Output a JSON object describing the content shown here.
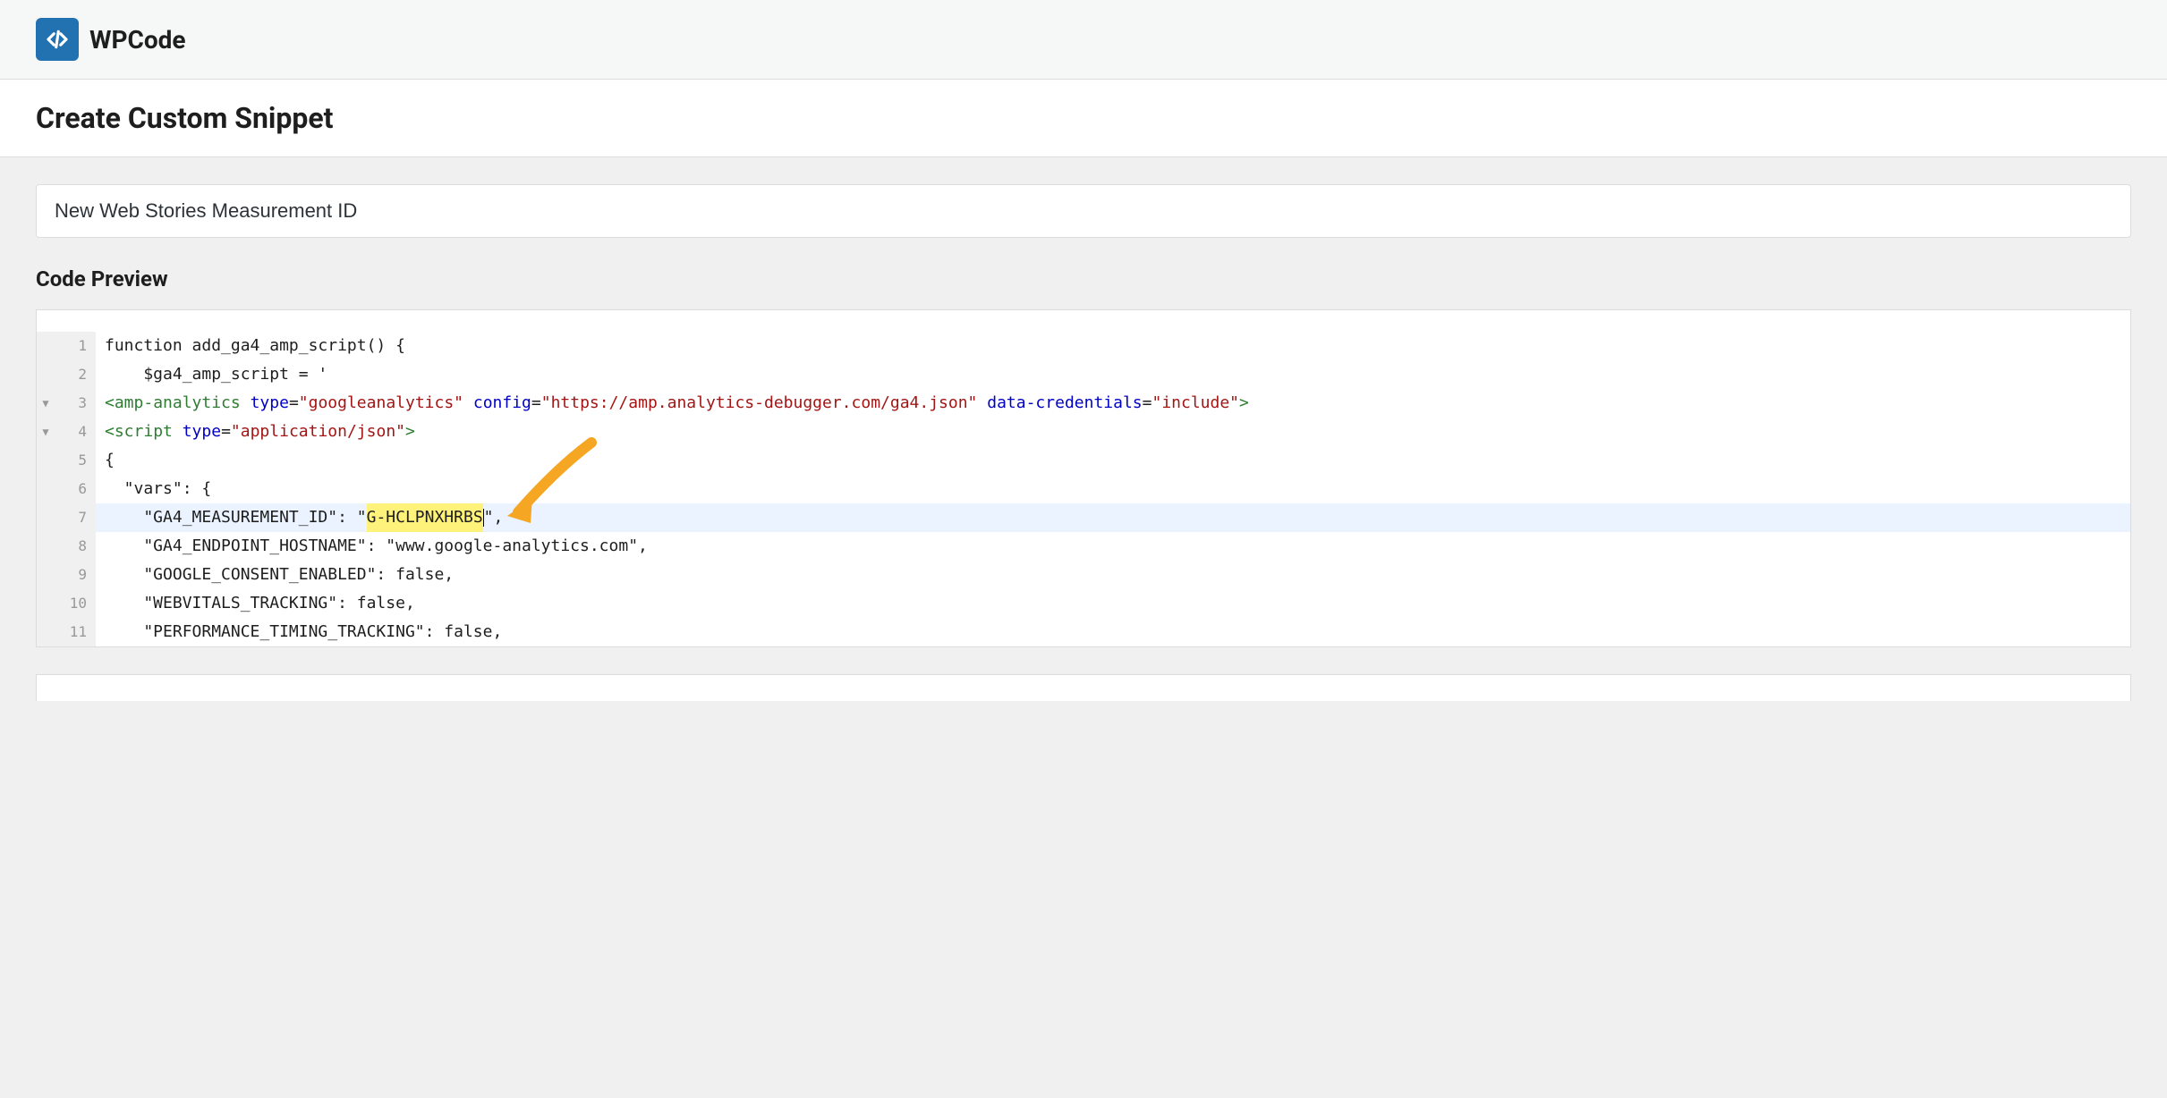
{
  "brand": {
    "name": "WPCode"
  },
  "page": {
    "title": "Create Custom Snippet"
  },
  "snippet": {
    "title_value": "New Web Stories Measurement ID"
  },
  "sections": {
    "code_preview_label": "Code Preview"
  },
  "code": {
    "lines": [
      {
        "num": "1",
        "fold": "",
        "tokens": [
          {
            "t": "function add_ga4_amp_script() {",
            "c": "tok-keyword"
          }
        ]
      },
      {
        "num": "2",
        "fold": "",
        "tokens": [
          {
            "t": "    $ga4_amp_script = '",
            "c": "tok-keyword"
          }
        ]
      },
      {
        "num": "3",
        "fold": "▼",
        "tokens": [
          {
            "t": "<",
            "c": "tok-tag"
          },
          {
            "t": "amp-analytics",
            "c": "tok-tag"
          },
          {
            "t": " ",
            "c": ""
          },
          {
            "t": "type",
            "c": "tok-attr"
          },
          {
            "t": "=",
            "c": "tok-punct"
          },
          {
            "t": "\"googleanalytics\"",
            "c": "tok-string"
          },
          {
            "t": " ",
            "c": ""
          },
          {
            "t": "config",
            "c": "tok-attr"
          },
          {
            "t": "=",
            "c": "tok-punct"
          },
          {
            "t": "\"https://amp.analytics-debugger.com/ga4.json\"",
            "c": "tok-string"
          },
          {
            "t": " ",
            "c": ""
          },
          {
            "t": "data-credentials",
            "c": "tok-attr"
          },
          {
            "t": "=",
            "c": "tok-punct"
          },
          {
            "t": "\"include\"",
            "c": "tok-string"
          },
          {
            "t": ">",
            "c": "tok-tag"
          }
        ]
      },
      {
        "num": "4",
        "fold": "▼",
        "tokens": [
          {
            "t": "<",
            "c": "tok-tag"
          },
          {
            "t": "script",
            "c": "tok-tag"
          },
          {
            "t": " ",
            "c": ""
          },
          {
            "t": "type",
            "c": "tok-attr"
          },
          {
            "t": "=",
            "c": "tok-punct"
          },
          {
            "t": "\"application/json\"",
            "c": "tok-string"
          },
          {
            "t": ">",
            "c": "tok-tag"
          }
        ]
      },
      {
        "num": "5",
        "fold": "",
        "tokens": [
          {
            "t": "{",
            "c": "tok-keyword"
          }
        ]
      },
      {
        "num": "6",
        "fold": "",
        "tokens": [
          {
            "t": "  \"vars\": {",
            "c": "tok-keyword"
          }
        ]
      },
      {
        "num": "7",
        "fold": "",
        "highlighted": true,
        "tokens": [
          {
            "t": "    \"GA4_MEASUREMENT_ID\": \"",
            "c": "tok-keyword"
          },
          {
            "t": "G-HCLPNXHRBS",
            "c": "tok-keyword",
            "hl": true
          },
          {
            "t": "\",",
            "c": "tok-keyword"
          }
        ]
      },
      {
        "num": "8",
        "fold": "",
        "tokens": [
          {
            "t": "    \"GA4_ENDPOINT_HOSTNAME\": \"www.google-analytics.com\",",
            "c": "tok-keyword"
          }
        ]
      },
      {
        "num": "9",
        "fold": "",
        "tokens": [
          {
            "t": "    \"GOOGLE_CONSENT_ENABLED\": false,",
            "c": "tok-keyword"
          }
        ]
      },
      {
        "num": "10",
        "fold": "",
        "tokens": [
          {
            "t": "    \"WEBVITALS_TRACKING\": false,",
            "c": "tok-keyword"
          }
        ]
      },
      {
        "num": "11",
        "fold": "",
        "tokens": [
          {
            "t": "    \"PERFORMANCE_TIMING_TRACKING\": false,",
            "c": "tok-keyword"
          }
        ]
      }
    ]
  },
  "annotation": {
    "arrow_color": "#f5a623"
  }
}
